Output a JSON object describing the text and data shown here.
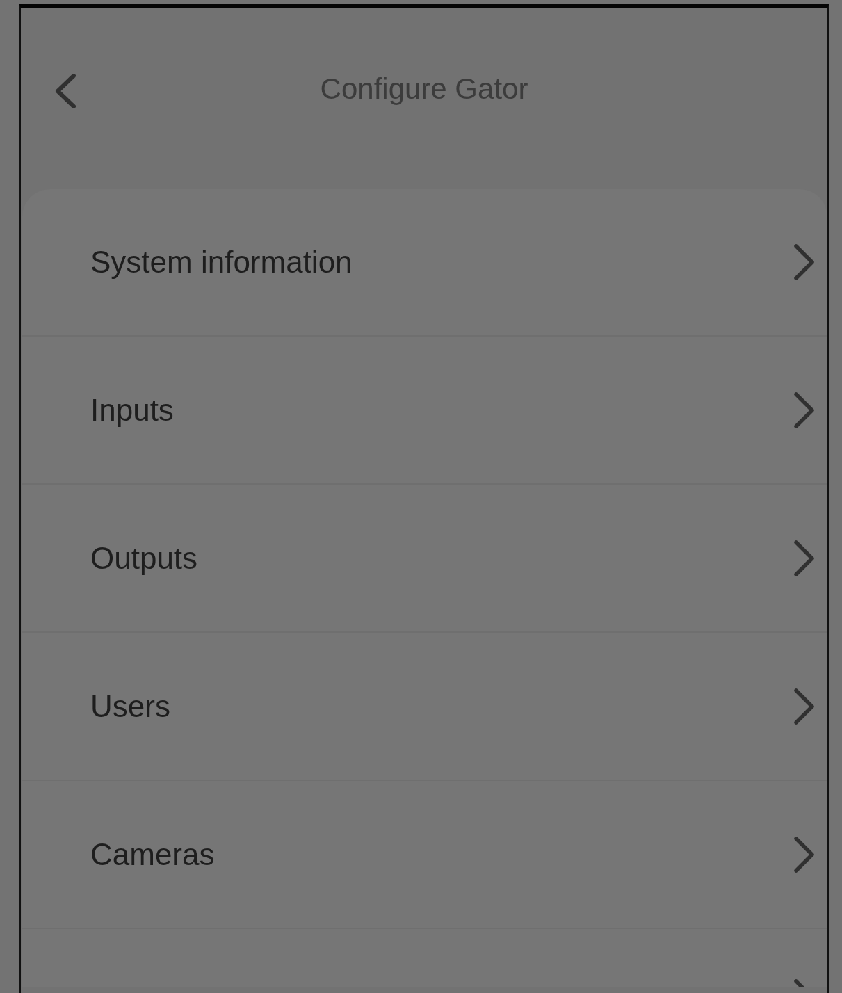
{
  "header": {
    "title": "Configure Gator"
  },
  "menu_items": [
    {
      "label": "System information"
    },
    {
      "label": "Inputs"
    },
    {
      "label": "Outputs"
    },
    {
      "label": "Users"
    },
    {
      "label": "Cameras"
    }
  ],
  "more_below": true
}
